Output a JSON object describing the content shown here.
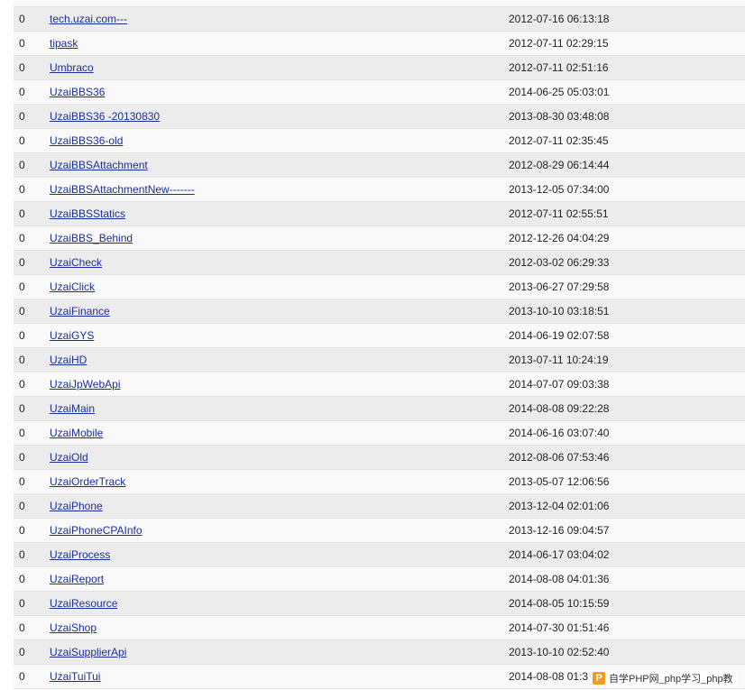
{
  "rows": [
    {
      "count": "",
      "name": "",
      "date": ""
    },
    {
      "count": "0",
      "name": "tech.uzai.com---",
      "date": "2012-07-16 06:13:18"
    },
    {
      "count": "0",
      "name": "tipask",
      "date": "2012-07-11 02:29:15"
    },
    {
      "count": "0",
      "name": "Umbraco",
      "date": "2012-07-11 02:51:16"
    },
    {
      "count": "0",
      "name": "UzaiBBS36",
      "date": "2014-06-25 05:03:01"
    },
    {
      "count": "0",
      "name": "UzaiBBS36 -20130830",
      "date": "2013-08-30 03:48:08"
    },
    {
      "count": "0",
      "name": "UzaiBBS36-old",
      "date": "2012-07-11 02:35:45"
    },
    {
      "count": "0",
      "name": "UzaiBBSAttachment",
      "date": "2012-08-29 06:14:44"
    },
    {
      "count": "0",
      "name": "UzaiBBSAttachmentNew-------",
      "date": "2013-12-05 07:34:00"
    },
    {
      "count": "0",
      "name": "UzaiBBSStatics",
      "date": "2012-07-11 02:55:51"
    },
    {
      "count": "0",
      "name": "UzaiBBS_Behind",
      "date": "2012-12-26 04:04:29"
    },
    {
      "count": "0",
      "name": "UzaiCheck",
      "date": "2012-03-02 06:29:33"
    },
    {
      "count": "0",
      "name": "UzaiClick",
      "date": "2013-06-27 07:29:58"
    },
    {
      "count": "0",
      "name": "UzaiFinance",
      "date": "2013-10-10 03:18:51"
    },
    {
      "count": "0",
      "name": "UzaiGYS",
      "date": "2014-06-19 02:07:58"
    },
    {
      "count": "0",
      "name": "UzaiHD",
      "date": "2013-07-11 10:24:19"
    },
    {
      "count": "0",
      "name": "UzaiJpWebApi",
      "date": "2014-07-07 09:03:38"
    },
    {
      "count": "0",
      "name": "UzaiMain",
      "date": "2014-08-08 09:22:28"
    },
    {
      "count": "0",
      "name": "UzaiMobile",
      "date": "2014-06-16 03:07:40"
    },
    {
      "count": "0",
      "name": "UzaiOld",
      "date": "2012-08-06 07:53:46"
    },
    {
      "count": "0",
      "name": "UzaiOrderTrack",
      "date": "2013-05-07 12:06:56"
    },
    {
      "count": "0",
      "name": "UzaiPhone",
      "date": "2013-12-04 02:01:06"
    },
    {
      "count": "0",
      "name": "UzaiPhoneCPAInfo",
      "date": "2013-12-16 09:04:57"
    },
    {
      "count": "0",
      "name": "UzaiProcess",
      "date": "2014-06-17 03:04:02"
    },
    {
      "count": "0",
      "name": "UzaiReport",
      "date": "2014-08-08 04:01:36"
    },
    {
      "count": "0",
      "name": "UzaiResource",
      "date": "2014-08-05 10:15:59"
    },
    {
      "count": "0",
      "name": "UzaiShop",
      "date": "2014-07-30 01:51:46"
    },
    {
      "count": "0",
      "name": "UzaiSupplierApi",
      "date": "2013-10-10 02:52:40"
    },
    {
      "count": "0",
      "name": "UzaiTuiTui",
      "date": "2014-08-08 01:3"
    }
  ],
  "watermark": {
    "logo": "P",
    "text": "自学PHP网_php学习_php教"
  },
  "colors": {
    "link": "#1b2f9a",
    "row_odd": "#f9f9f9",
    "row_even": "#ececec",
    "watermark_logo": "#f39a1f"
  }
}
